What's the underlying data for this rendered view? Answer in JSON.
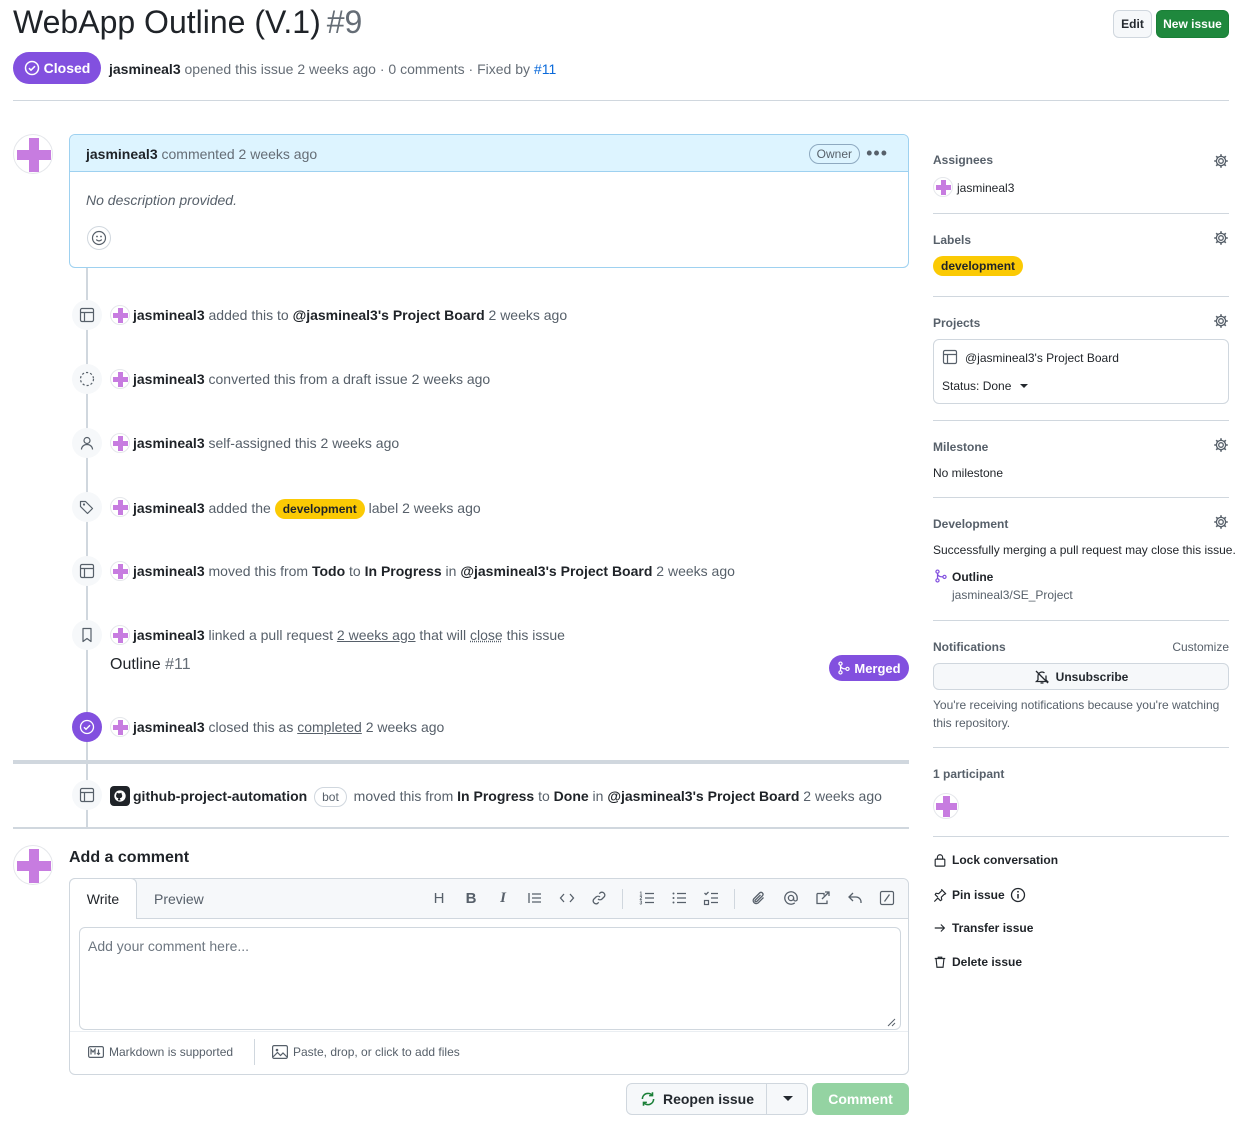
{
  "issue": {
    "title": "WebApp Outline (V.1)",
    "number": "#9",
    "state": "Closed",
    "author": "jasmineal3",
    "meta_text": "opened this issue 2 weeks ago · 0 comments · Fixed by",
    "fixed_by": "#11"
  },
  "header_buttons": {
    "edit": "Edit",
    "new_issue": "New issue"
  },
  "comment": {
    "author": "jasmineal3",
    "time": "commented 2 weeks ago",
    "role": "Owner",
    "body": "No description provided."
  },
  "timeline": [
    {
      "icon": "table-icon",
      "user": "jasmineal3",
      "parts": [
        "added this to",
        "@jasmineal3's Project Board",
        "2 weeks ago"
      ]
    },
    {
      "icon": "dashed-circle-icon",
      "user": "jasmineal3",
      "text": "converted this from a draft issue 2 weeks ago"
    },
    {
      "icon": "person-icon",
      "user": "jasmineal3",
      "text": "self-assigned this 2 weeks ago"
    },
    {
      "icon": "tag-icon",
      "user": "jasmineal3",
      "pre": "added the",
      "label": "development",
      "post": "label 2 weeks ago"
    },
    {
      "icon": "table-icon",
      "user": "jasmineal3",
      "parts": [
        "moved this from",
        "Todo",
        "to",
        "In Progress",
        "in",
        "@jasmineal3's Project Board",
        "2 weeks ago"
      ]
    },
    {
      "icon": "bookmark-icon",
      "user": "jasmineal3",
      "parts": [
        "linked a pull request",
        "2 weeks ago",
        "that will",
        "close",
        "this issue"
      ],
      "pr_title": "Outline",
      "pr_number": "#11",
      "pr_state": "Merged"
    },
    {
      "icon": "check-circle-icon",
      "user": "jasmineal3",
      "parts": [
        "closed this as",
        "completed",
        "2 weeks ago"
      ]
    },
    {
      "icon": "table-icon",
      "user": "github-project-automation",
      "bot": "bot",
      "parts": [
        "moved this from",
        "In Progress",
        "to",
        "Done",
        "in",
        "@jasmineal3's Project Board",
        "2 weeks ago"
      ]
    }
  ],
  "composer": {
    "title": "Add a comment",
    "tab_write": "Write",
    "tab_preview": "Preview",
    "placeholder": "Add your comment here...",
    "markdown": "Markdown is supported",
    "attach": "Paste, drop, or click to add files",
    "reopen": "Reopen issue",
    "submit": "Comment"
  },
  "sidebar": {
    "assignees_h": "Assignees",
    "assignee": "jasmineal3",
    "labels_h": "Labels",
    "label": "development",
    "projects_h": "Projects",
    "project_name": "@jasmineal3's Project Board",
    "project_status": "Status: Done",
    "milestone_h": "Milestone",
    "milestone": "No milestone",
    "development_h": "Development",
    "development_text": "Successfully merging a pull request may close this issue.",
    "pr_name": "Outline",
    "pr_repo": "jasmineal3/SE_Project",
    "notifications_h": "Notifications",
    "customize": "Customize",
    "unsubscribe": "Unsubscribe",
    "notif_text_1": "You're receiving notifications because you're watching",
    "notif_text_2": "this repository.",
    "participants_h": "1 participant",
    "lock": "Lock conversation",
    "pin": "Pin issue",
    "transfer": "Transfer issue",
    "delete": "Delete issue"
  },
  "colors": {
    "closed": "#8250df",
    "label": "#fbca04",
    "green": "#1f883d",
    "link": "#0969da"
  }
}
